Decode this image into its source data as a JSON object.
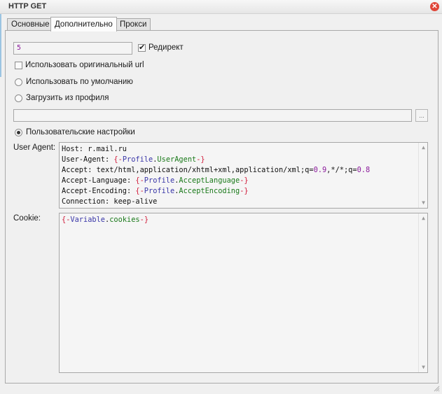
{
  "window": {
    "title": "HTTP GET",
    "close_glyph": "✕"
  },
  "tabs": [
    {
      "label": "Основные"
    },
    {
      "label": "Дополнительно"
    },
    {
      "label": "Прокси"
    }
  ],
  "redirect": {
    "count_value": "5",
    "checkbox_label": "Редирект",
    "checked": true
  },
  "use_original_url": {
    "label": "Использовать оригинальный url",
    "checked": false
  },
  "radio_default": {
    "label": "Использовать по умолчанию"
  },
  "radio_profile": {
    "label": "Загрузить из профиля",
    "path_value": "",
    "browse_label": "..."
  },
  "radio_custom": {
    "label": "Пользовательские настройки",
    "selected": true
  },
  "user_agent": {
    "label": "User Agent:",
    "lines": [
      {
        "a": "Host: r.mail.ru"
      },
      {
        "a": "User-Agent: ",
        "b": "{-",
        "c": "Profile",
        "d": ".",
        "e": "UserAgent",
        "f": "-}"
      },
      {
        "a": "Accept: text/html,application/xhtml+xml,application/xml;q=",
        "n1": "0.9",
        "m": ",*/*;q=",
        "n2": "0.8"
      },
      {
        "a": "Accept-Language: ",
        "b": "{-",
        "c": "Profile",
        "d": ".",
        "e": "AcceptLanguage",
        "f": "-}"
      },
      {
        "a": "Accept-Encoding: ",
        "b": "{-",
        "c": "Profile",
        "d": ".",
        "e": "AcceptEncoding",
        "f": "-}"
      },
      {
        "a": "Connection: keep-alive"
      }
    ]
  },
  "cookie": {
    "label": "Cookie:",
    "line": {
      "b": "{-",
      "c": "Variable",
      "d": ".",
      "e": "cookies",
      "f": "-}"
    }
  },
  "colors": {
    "macro": "#d11b3a",
    "object": "#3a37a8",
    "property": "#1b7a1b",
    "number": "#8b1a9b",
    "close": "#e04538"
  }
}
